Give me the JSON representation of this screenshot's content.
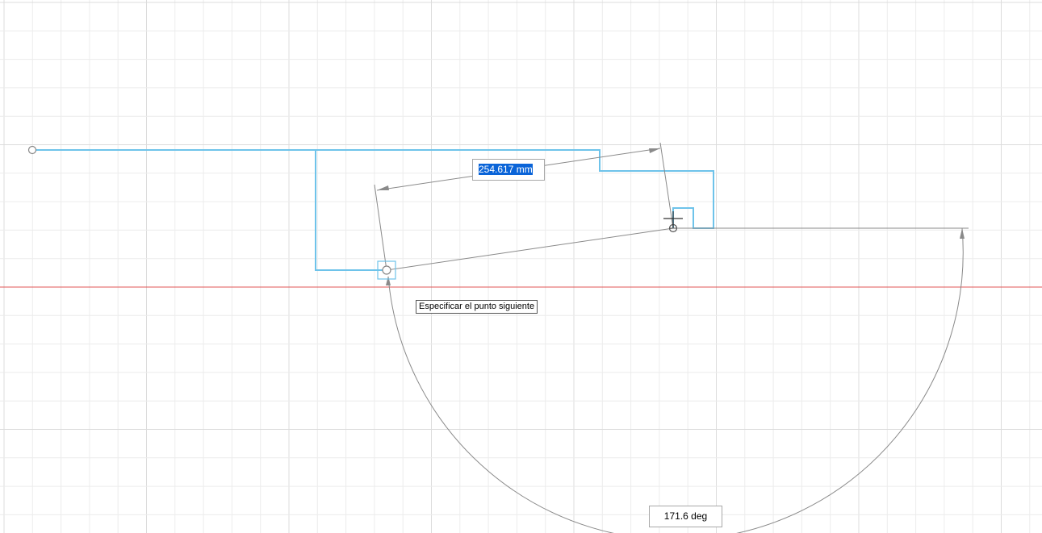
{
  "sketch": {
    "length_input": {
      "value": "254.617",
      "unit": "mm"
    },
    "prompt_tooltip": "Especificar el punto siguiente",
    "angle_readout": "171.6 deg"
  },
  "colors": {
    "background": "#ffffff",
    "grid_minor": "#ececec",
    "grid_major": "#dcdcdc",
    "sketch_line": "#6ec3ea",
    "dimension_line": "#8a8a8a",
    "x_axis": "#e05555",
    "selection": "#0a64d8"
  },
  "icons": {
    "cursor": "crosshair-cursor-icon",
    "snap": "point-snap-icon"
  }
}
